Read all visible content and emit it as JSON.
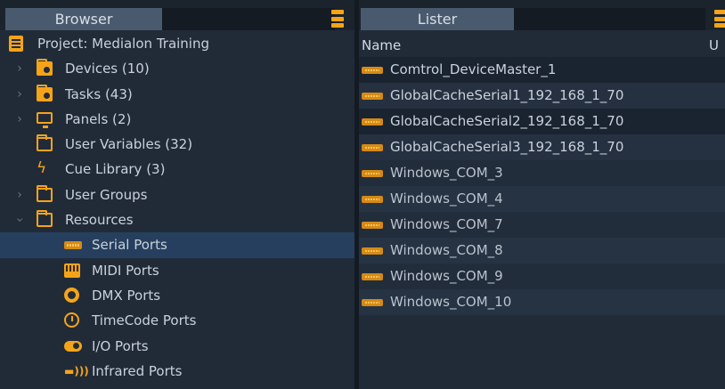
{
  "browser": {
    "tab_label": "Browser",
    "project": "Project: Medialon Training",
    "items": [
      {
        "label": "Devices (10)",
        "icon": "folder-gear-icon",
        "expandable": true
      },
      {
        "label": "Tasks (43)",
        "icon": "folder-task-icon",
        "expandable": true
      },
      {
        "label": "Panels (2)",
        "icon": "monitor-icon",
        "expandable": true
      },
      {
        "label": "User Variables (32)",
        "icon": "folder-variables-icon",
        "expandable": false
      },
      {
        "label": "Cue Library (3)",
        "icon": "lightning-icon",
        "expandable": false
      },
      {
        "label": "User Groups",
        "icon": "folder-icon",
        "expandable": true
      },
      {
        "label": "Resources",
        "icon": "folder-icon",
        "expandable": true,
        "expanded": true
      }
    ],
    "resources": [
      {
        "label": "Serial Ports",
        "icon": "serial-port-icon",
        "selected": true
      },
      {
        "label": "MIDI Ports",
        "icon": "midi-port-icon"
      },
      {
        "label": "DMX Ports",
        "icon": "dmx-port-icon"
      },
      {
        "label": "TimeCode Ports",
        "icon": "timecode-icon"
      },
      {
        "label": "I/O Ports",
        "icon": "io-port-icon"
      },
      {
        "label": "Infrared Ports",
        "icon": "infrared-icon"
      }
    ]
  },
  "lister": {
    "tab_label": "Lister",
    "col_name": "Name",
    "col_u": "U",
    "rows": [
      "Comtrol_DeviceMaster_1",
      "GlobalCacheSerial1_192_168_1_70",
      "GlobalCacheSerial2_192_168_1_70",
      "GlobalCacheSerial3_192_168_1_70",
      "Windows_COM_3",
      "Windows_COM_4",
      "Windows_COM_7",
      "Windows_COM_8",
      "Windows_COM_9",
      "Windows_COM_10"
    ]
  },
  "colors": {
    "accent": "#f5a419",
    "selection": "#263f5e",
    "panel_bg": "#212b38",
    "tab_active": "#4a5a6e"
  }
}
